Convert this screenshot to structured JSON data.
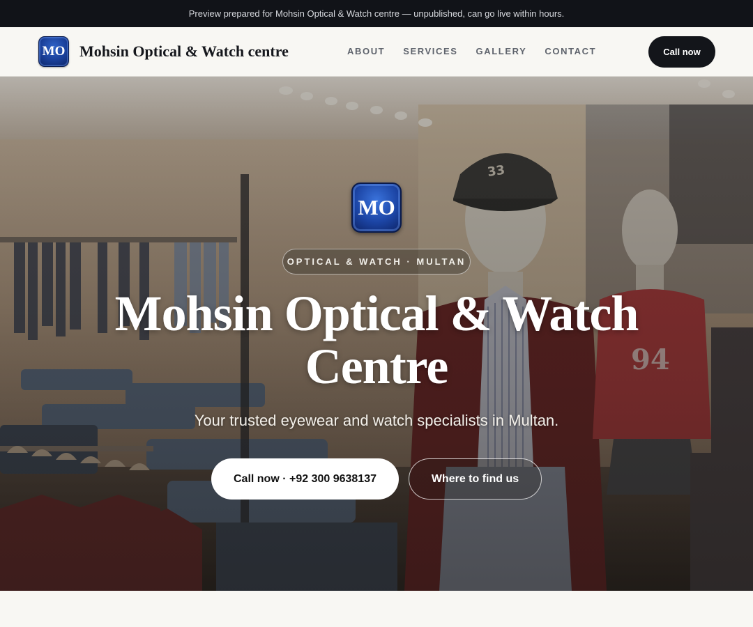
{
  "announcement": "Preview prepared for Mohsin Optical & Watch centre — unpublished, can go live within hours.",
  "nav": {
    "logo_initials": "MO",
    "brand_name": "Mohsin Optical & Watch centre",
    "links": [
      {
        "label": "ABOUT"
      },
      {
        "label": "SERVICES"
      },
      {
        "label": "GALLERY"
      },
      {
        "label": "CONTACT"
      }
    ],
    "cta_label": "Call now"
  },
  "hero": {
    "logo_initials": "MO",
    "eyebrow": "OPTICAL & WATCH · MULTAN",
    "title": "Mohsin Optical & Watch Centre",
    "subtitle": "Your trusted eyewear and watch specialists in Multan.",
    "primary_cta": "Call now · +92 300 9638137",
    "secondary_cta": "Where to find us",
    "cap_text": "33"
  },
  "colors": {
    "topbar_bg": "#111318",
    "page_bg": "#f8f7f3",
    "cta_dark": "#13151a",
    "logo_blue": "#1c45a5"
  }
}
